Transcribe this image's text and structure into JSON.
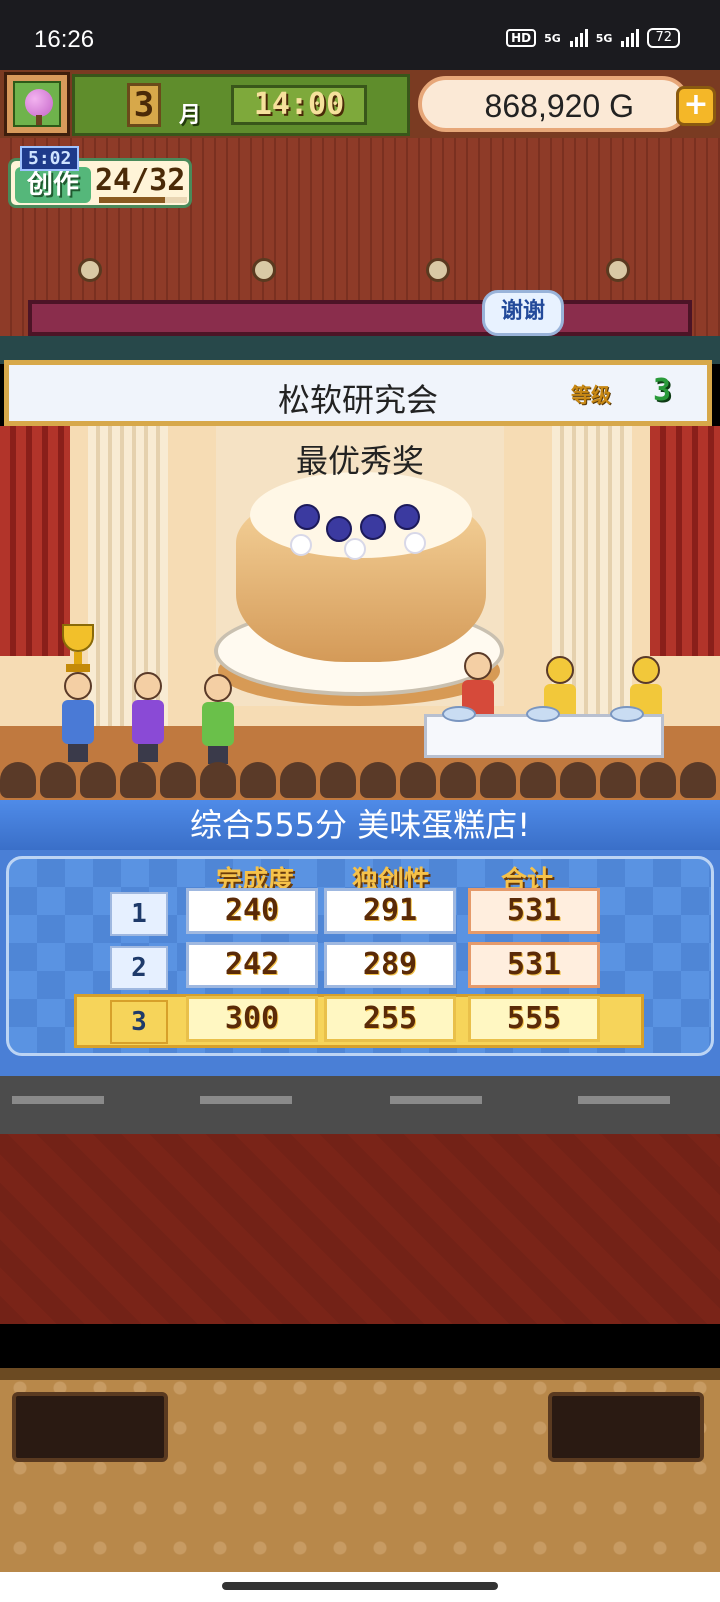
{
  "status_bar": {
    "time": "16:26",
    "hd_label": "HD",
    "sim1_label": "5G",
    "sim2_label": "5G",
    "battery": "72"
  },
  "hud": {
    "month_num": "3",
    "month_label": "月",
    "clock": "14:00",
    "money": "868,920 G",
    "add_label": "+"
  },
  "create": {
    "timer": "5:02",
    "label": "创作",
    "count": "24/32",
    "progress_fraction": 0.75
  },
  "speech_bubble": "谢谢",
  "banner": {
    "title": "松软研究会",
    "level_label": "等级",
    "level_value": "3"
  },
  "award": {
    "title": "最优秀奖"
  },
  "results": {
    "header": "综合555分 美味蛋糕店!",
    "columns": [
      "完成度",
      "独创性",
      "合计"
    ],
    "rows": [
      {
        "rank": "1",
        "completion": "240",
        "originality": "291",
        "total": "531"
      },
      {
        "rank": "2",
        "completion": "242",
        "originality": "289",
        "total": "531"
      },
      {
        "rank": "3",
        "completion": "300",
        "originality": "255",
        "total": "555"
      }
    ],
    "highlighted_rank": "3"
  },
  "colors": {
    "results_blue": "#4a7fd6",
    "gold_header": "#f6c24a",
    "money_pill": "#fbe9d6",
    "level_green": "#2a9a3a"
  }
}
